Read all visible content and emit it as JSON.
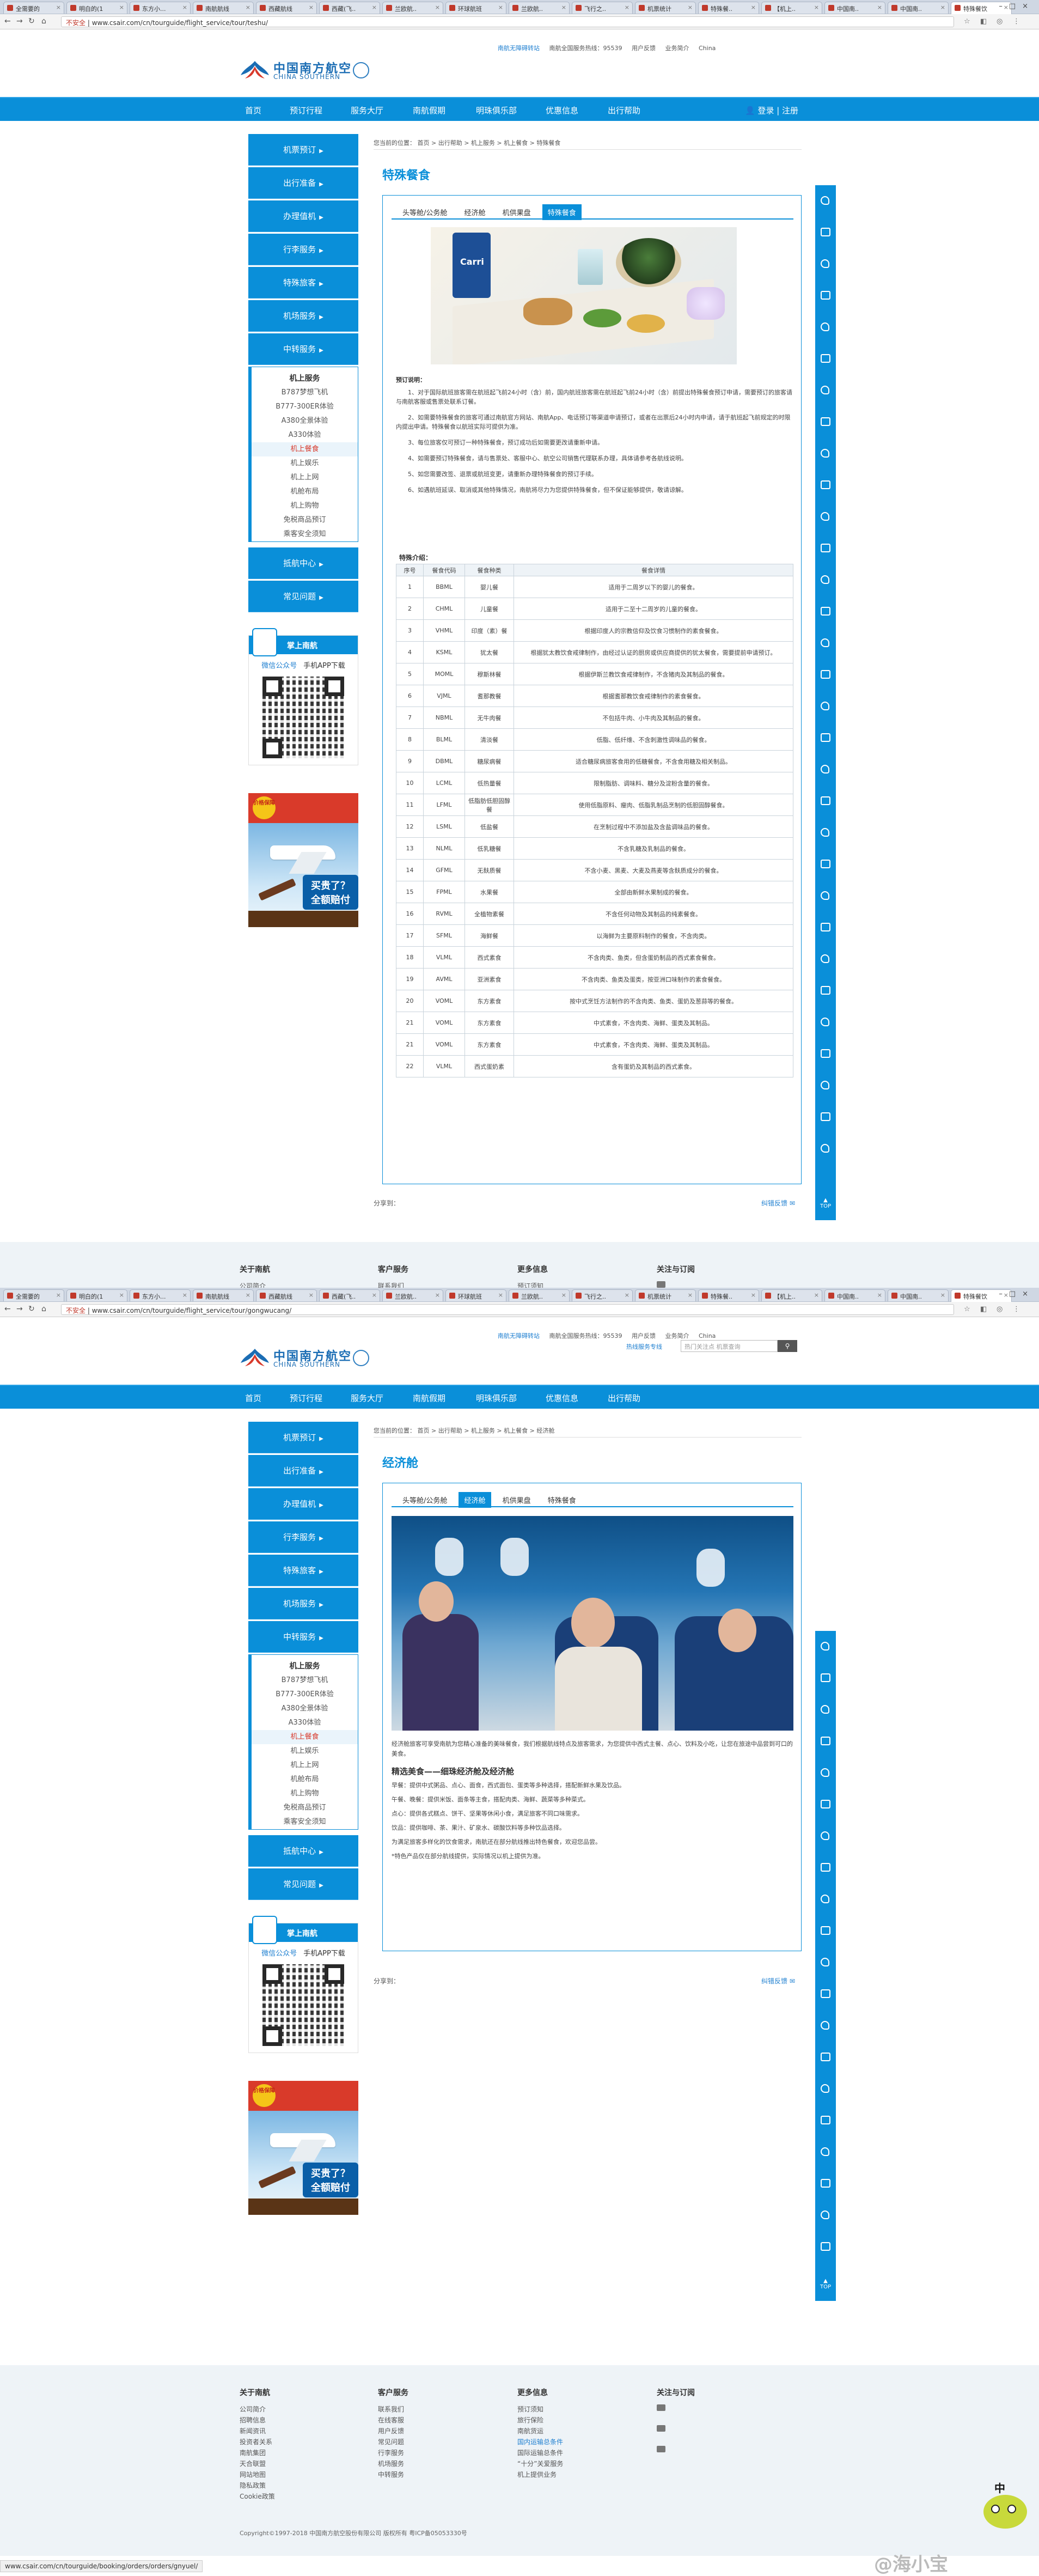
{
  "browser": {
    "tabs": [
      "全需要的",
      "明白的(1",
      "东方小...",
      "南航航线",
      "西藏航线",
      "西藏(飞..",
      "兰欧航..",
      "环球航班",
      "兰欧航..",
      "飞行之..",
      "机票统计",
      "特殊餐..",
      "【机上..",
      "中国南..",
      "中国南..",
      "特殊餐饮"
    ],
    "active_tab_label": "特殊餐饮",
    "insecure_label": "不安全",
    "url_page1": "www.csair.com/cn/tourguide/flight_service/tour/teshu/",
    "url_page2": "www.csair.com/cn/tourguide/flight_service/tour/gongwucang/",
    "status_url": "www.csair.com/cn/tourguide/booking/orders/orders/gnyuel/"
  },
  "header": {
    "logo_cn": "中国南方航空",
    "logo_en": "CHINA SOUTHERN",
    "top_links": [
      "南航无障碍转站",
      "南航全国服务热线：95539",
      "用户反馈",
      "业务简介",
      "China"
    ],
    "hotline_label": "热线服务专线",
    "search_placeholder": "热门关注点 机票查询",
    "search_button": "搜索"
  },
  "nav": {
    "items": [
      "首页",
      "预订行程",
      "服务大厅",
      "南航假期",
      "明珠俱乐部",
      "优惠信息",
      "出行帮助"
    ],
    "login": "登录 | 注册"
  },
  "sidebar": {
    "items": [
      "机票预订",
      "出行准备",
      "办理值机",
      "行李服务",
      "特殊旅客",
      "机场服务",
      "中转服务"
    ],
    "sub_header": "机上服务",
    "sub_items": [
      "B787梦想飞机",
      "B777-300ER体验",
      "A380全景体验",
      "A330体验",
      "机上餐食",
      "机上娱乐",
      "机上上网",
      "机舱布局",
      "机上购物",
      "免税商品预订",
      "乘客安全须知"
    ],
    "items_after": [
      "抵航中心",
      "常见问题"
    ]
  },
  "mobile": {
    "title": "掌上南航",
    "tabs": [
      "微信公众号",
      "手机APP下载"
    ]
  },
  "ad": {
    "badge": "价格保障",
    "text": "买贵了？全额赔付"
  },
  "page1": {
    "breadcrumb": "您当前的位置： 首页 > 出行帮助 > 机上服务 > 机上餐食 > 特殊餐食",
    "title": "特殊餐食",
    "tabs": [
      "头等舱/公务舱",
      "经济舱",
      "机供果盘",
      "特殊餐食"
    ],
    "food_brand": "Carri",
    "notice_header": "预订说明：",
    "notices": [
      "1、对于国际航班旅客需在航班起飞前24小时（含）前，国内航班旅客需在航班起飞前24小时（含）前提出特殊餐食预订申请，需要预订的旅客请与南航客服或售票处联系订餐。",
      "2、如需要特殊餐食的旅客可通过南航官方网站、南航App、电话预订等渠道申请预订，或者在出票后24小时内申请，请于航班起飞前规定的时限内提出申请。特殊餐食以航班实际可提供为准。",
      "3、每位旅客仅可预订一种特殊餐食，预订成功后如需要更改请重新申请。",
      "4、如需要预订特殊餐食，请与售票处、客服中心、航空公司销售代理联系办理，具体请参考各航线说明。",
      "5、如您需要改签、退票或航班变更，请重新办理特殊餐食的预订手续。",
      "6、如遇航班延误、取消或其他特殊情况，南航将尽力为您提供特殊餐食，但不保证能够提供，敬请谅解。"
    ],
    "meal_title": "特殊介绍：",
    "table_headers": [
      "序号",
      "餐食代码",
      "餐食种类",
      "餐食详情"
    ],
    "meals": [
      [
        "1",
        "BBML",
        "婴儿餐",
        "适用于二周岁以下的婴儿的餐食。"
      ],
      [
        "2",
        "CHML",
        "儿童餐",
        "适用于二至十二周岁的儿童的餐食。"
      ],
      [
        "3",
        "VHML",
        "印度（素）餐",
        "根据印度人的宗教信仰及饮食习惯制作的素食餐食。"
      ],
      [
        "4",
        "KSML",
        "犹太餐",
        "根据犹太教饮食戒律制作，由经过认证的厨房或供应商提供的犹太餐食，需要提前申请预订。"
      ],
      [
        "5",
        "MOML",
        "穆斯林餐",
        "根据伊斯兰教饮食戒律制作，不含猪肉及其制品的餐食。"
      ],
      [
        "6",
        "VJML",
        "耆那教餐",
        "根据耆那教饮食戒律制作的素食餐食。"
      ],
      [
        "7",
        "NBML",
        "无牛肉餐",
        "不包括牛肉、小牛肉及其制品的餐食。"
      ],
      [
        "8",
        "BLML",
        "清淡餐",
        "低脂、低纤维、不含刺激性调味品的餐食。"
      ],
      [
        "9",
        "DBML",
        "糖尿病餐",
        "适合糖尿病旅客食用的低糖餐食，不含食用糖及相关制品。"
      ],
      [
        "10",
        "LCML",
        "低热量餐",
        "限制脂肪、调味料、糖分及淀粉含量的餐食。"
      ],
      [
        "11",
        "LFML",
        "低脂肪低胆固醇餐",
        "使用低脂原料、瘦肉、低脂乳制品烹制的低胆固醇餐食。"
      ],
      [
        "12",
        "LSML",
        "低盐餐",
        "在烹制过程中不添加盐及含盐调味品的餐食。"
      ],
      [
        "13",
        "NLML",
        "低乳糖餐",
        "不含乳糖及乳制品的餐食。"
      ],
      [
        "14",
        "GFML",
        "无麸质餐",
        "不含小麦、黑麦、大麦及燕麦等含麸质成分的餐食。"
      ],
      [
        "15",
        "FPML",
        "水果餐",
        "全部由新鲜水果制成的餐食。"
      ],
      [
        "16",
        "RVML",
        "全植物素餐",
        "不含任何动物及其制品的纯素餐食。"
      ],
      [
        "17",
        "SFML",
        "海鲜餐",
        "以海鲜为主要原料制作的餐食，不含肉类。"
      ],
      [
        "18",
        "VLML",
        "西式素食",
        "不含肉类、鱼类，但含蛋奶制品的西式素食餐食。"
      ],
      [
        "19",
        "AVML",
        "亚洲素食",
        "不含肉类、鱼类及蛋类，按亚洲口味制作的素食餐食。"
      ],
      [
        "20",
        "VOML",
        "东方素食",
        "按中式烹饪方法制作的不含肉类、鱼类、蛋奶及葱蒜等的餐食。"
      ],
      [
        "21",
        "VOML",
        "东方素食",
        "中式素食，不含肉类、海鲜、蛋类及其制品。"
      ],
      [
        "21",
        "VOML",
        "东方素食",
        "中式素食，不含肉类、海鲜、蛋类及其制品。"
      ],
      [
        "22",
        "VLML",
        "西式蛋奶素",
        "含有蛋奶及其制品的西式素食。"
      ]
    ],
    "share_label": "分享到：",
    "share_right": "纠错反馈"
  },
  "page2": {
    "breadcrumb": "您当前的位置： 首页 > 出行帮助 > 机上服务 > 机上餐食 > 经济舱",
    "title": "经济舱",
    "tabs": [
      "头等舱/公务舱",
      "经济舱",
      "机供果盘",
      "特殊餐食"
    ],
    "intro": "经济舱旅客可享受南航为您精心准备的美味餐食，我们根据航线特点及旅客需求，为您提供中西式主餐、点心、饮料及小吃，让您在旅途中品尝到可口的美食。",
    "article_title": "精选美食——细珠经济舱及经济舱",
    "paras": [
      "早餐：提供中式粥品、点心、面食，西式面包、蛋类等多种选择，搭配新鲜水果及饮品。",
      "午餐、晚餐：提供米饭、面条等主食，搭配肉类、海鲜、蔬菜等多种菜式。",
      "点心：提供各式糕点、饼干、坚果等休闲小食，满足旅客不同口味需求。",
      "饮品：提供咖啡、茶、果汁、矿泉水、碳酸饮料等多种饮品选择。",
      "为满足旅客多样化的饮食需求，南航还在部分航线推出特色餐食，欢迎您品尝。",
      "*特色产品仅在部分航线提供，实际情况以机上提供为准。"
    ],
    "share_label": "分享到：",
    "share_right": "纠错反馈"
  },
  "footer": {
    "cols": [
      {
        "title": "关于南航",
        "items": [
          "公司简介",
          "招聘信息",
          "新闻资讯",
          "投资者关系",
          "南航集团",
          "天合联盟",
          "网站地图",
          "隐私政策",
          "Cookie政策"
        ]
      },
      {
        "title": "客户服务",
        "items": [
          "联系我们",
          "在线客服",
          "用户反馈",
          "常见问题",
          "行李服务",
          "机场服务",
          "中转服务"
        ]
      },
      {
        "title": "更多信息",
        "items": [
          "预订须知",
          "旅行保险",
          "南航货运",
          "国内运输总条件",
          "国际运输总条件",
          "“十分”关爱服务",
          "机上提供业务"
        ]
      },
      {
        "title": "关注与订阅",
        "items": []
      }
    ],
    "copyright": "Copyright©1997-2018 中国南方航空股份有限公司 版权所有 粤ICP备05053330号"
  },
  "right_toolbar": {
    "top_label": "TOP"
  },
  "mascot": {
    "label": "中"
  },
  "watermark": "@海小宝"
}
